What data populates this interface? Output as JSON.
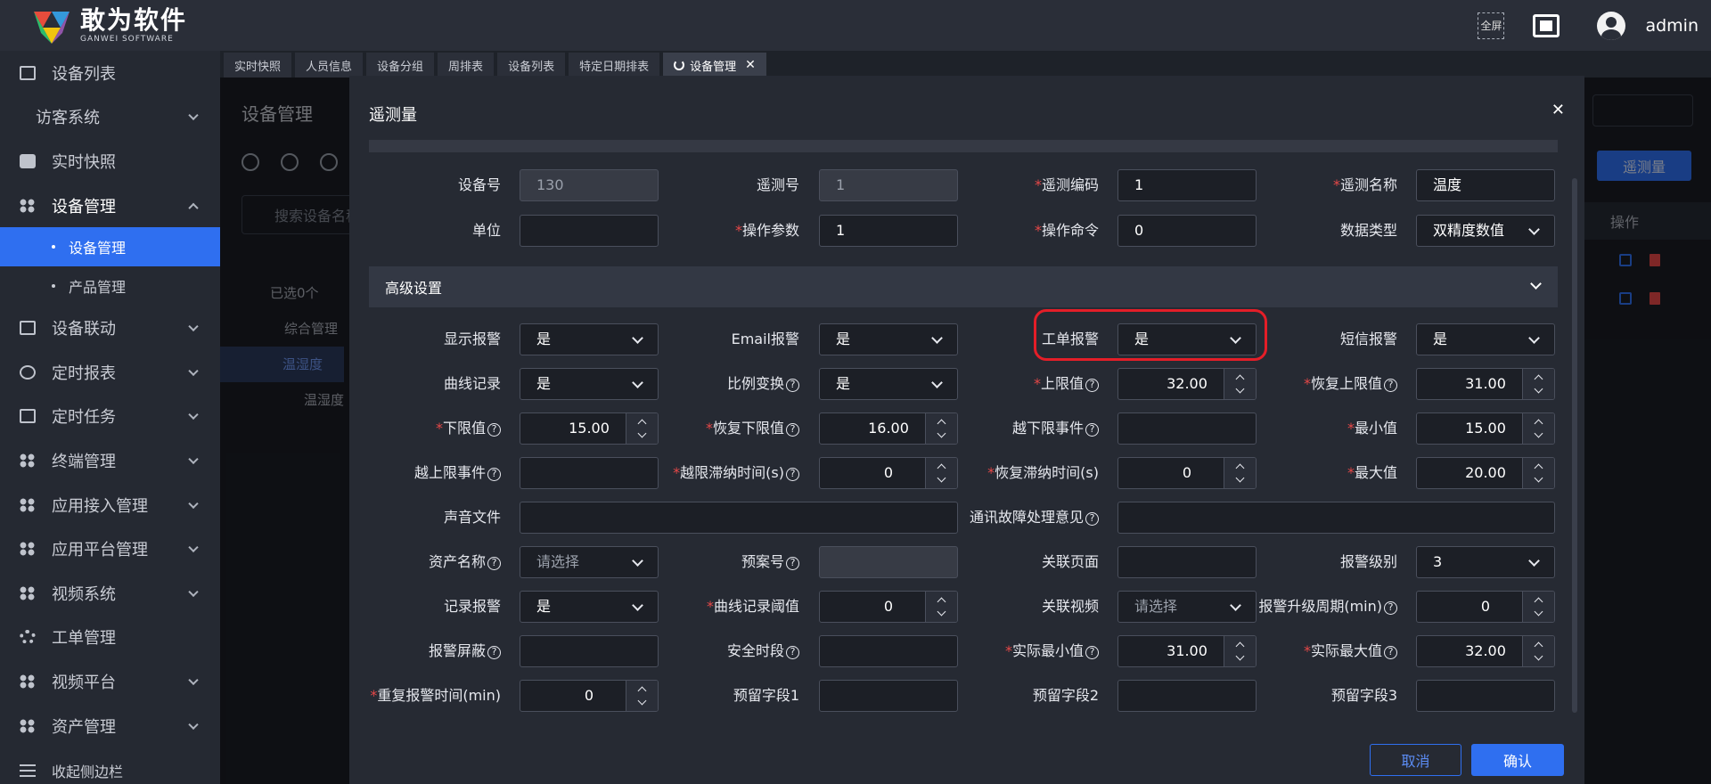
{
  "brand": {
    "name_cn": "敢为软件",
    "name_en": "GANWEI SOFTWARE"
  },
  "topbar": {
    "fullscreen_label": "全屏",
    "user": "admin"
  },
  "sidebar": {
    "items": [
      {
        "label": "设备列表",
        "icon": "monitor-icon",
        "chevron": false
      },
      {
        "label": "访客系统",
        "icon": "none",
        "chevron": true
      },
      {
        "label": "实时快照",
        "icon": "camera-icon",
        "chevron": false
      },
      {
        "label": "设备管理",
        "icon": "grid-icon",
        "chevron": true,
        "open": true
      },
      {
        "label": "设备联动",
        "icon": "link-icon",
        "chevron": true
      },
      {
        "label": "定时报表",
        "icon": "clock-icon",
        "chevron": true
      },
      {
        "label": "定时任务",
        "icon": "task-icon",
        "chevron": true
      },
      {
        "label": "终端管理",
        "icon": "grid-icon",
        "chevron": true
      },
      {
        "label": "应用接入管理",
        "icon": "grid-icon",
        "chevron": true
      },
      {
        "label": "应用平台管理",
        "icon": "grid-icon",
        "chevron": true
      },
      {
        "label": "视频系统",
        "icon": "grid-icon",
        "chevron": true
      },
      {
        "label": "工单管理",
        "icon": "gear-icon",
        "chevron": false
      },
      {
        "label": "视频平台",
        "icon": "grid-icon",
        "chevron": true
      },
      {
        "label": "资产管理",
        "icon": "grid-icon",
        "chevron": true
      }
    ],
    "sub_items": [
      "设备管理",
      "产品管理"
    ],
    "collapse_label": "收起侧边栏"
  },
  "tabs": [
    {
      "label": "实时快照"
    },
    {
      "label": "人员信息"
    },
    {
      "label": "设备分组"
    },
    {
      "label": "周排表"
    },
    {
      "label": "设备列表"
    },
    {
      "label": "特定日期排表"
    },
    {
      "label": "设备管理",
      "active": true
    }
  ],
  "background": {
    "title": "设备管理",
    "search_placeholder": "搜索设备名称",
    "selected_count": "已选0个",
    "tree": [
      "综合管理",
      "温湿度",
      "温湿度"
    ],
    "add_button": "遥测量",
    "table_header": "操作"
  },
  "dialog": {
    "title": "遥测量",
    "section_title": "高级设置",
    "basic": {
      "device_no": {
        "label": "设备号",
        "value": "130"
      },
      "tele_no": {
        "label": "遥测号",
        "value": "1"
      },
      "tele_code": {
        "label": "遥测编码",
        "value": "1"
      },
      "tele_name": {
        "label": "遥测名称",
        "value": "温度"
      },
      "unit": {
        "label": "单位",
        "value": ""
      },
      "op_param": {
        "label": "操作参数",
        "value": "1"
      },
      "op_cmd": {
        "label": "操作命令",
        "value": "0"
      },
      "data_type": {
        "label": "数据类型",
        "value": "双精度数值"
      }
    },
    "adv": {
      "show_alarm": {
        "label": "显示报警",
        "value": "是"
      },
      "email_alarm": {
        "label": "Email报警",
        "value": "是"
      },
      "ticket_alarm": {
        "label": "工单报警",
        "value": "是"
      },
      "sms_alarm": {
        "label": "短信报警",
        "value": "是"
      },
      "curve_record": {
        "label": "曲线记录",
        "value": "是"
      },
      "ratio_transform": {
        "label": "比例变换",
        "value": "是"
      },
      "upper_limit": {
        "label": "上限值",
        "value": "32.00"
      },
      "restore_upper": {
        "label": "恢复上限值",
        "value": "31.00"
      },
      "lower_limit": {
        "label": "下限值",
        "value": "15.00"
      },
      "restore_lower": {
        "label": "恢复下限值",
        "value": "16.00"
      },
      "below_event": {
        "label": "越下限事件",
        "value": ""
      },
      "min_value": {
        "label": "最小值",
        "value": "15.00"
      },
      "above_event": {
        "label": "越上限事件",
        "value": ""
      },
      "limit_delay": {
        "label": "越限滞纳时间(s)",
        "value": "0"
      },
      "restore_delay": {
        "label": "恢复滞纳时间(s)",
        "value": "0"
      },
      "max_value": {
        "label": "最大值",
        "value": "20.00"
      },
      "sound_file": {
        "label": "声音文件",
        "value": ""
      },
      "comm_fault": {
        "label": "通讯故障处理意见",
        "value": ""
      },
      "asset_name": {
        "label": "资产名称",
        "value": "请选择"
      },
      "plan_no": {
        "label": "预案号",
        "value": ""
      },
      "related_page": {
        "label": "关联页面",
        "value": ""
      },
      "alarm_level": {
        "label": "报警级别",
        "value": "3"
      },
      "record_alarm": {
        "label": "记录报警",
        "value": "是"
      },
      "curve_threshold": {
        "label": "曲线记录阈值",
        "value": "0"
      },
      "related_video": {
        "label": "关联视频",
        "value": "请选择"
      },
      "alarm_upgrade": {
        "label": "报警升级周期(min)",
        "value": "0"
      },
      "alarm_mask": {
        "label": "报警屏蔽",
        "value": ""
      },
      "safe_period": {
        "label": "安全时段",
        "value": ""
      },
      "actual_min": {
        "label": "实际最小值",
        "value": "31.00"
      },
      "actual_max": {
        "label": "实际最大值",
        "value": "32.00"
      },
      "repeat_alarm": {
        "label": "重复报警时间(min)",
        "value": "0"
      },
      "reserve1": {
        "label": "预留字段1",
        "value": ""
      },
      "reserve2": {
        "label": "预留字段2",
        "value": ""
      },
      "reserve3": {
        "label": "预留字段3",
        "value": ""
      }
    },
    "cancel_label": "取消",
    "ok_label": "确认"
  },
  "colors": {
    "accent": "#2f6ff0",
    "highlight": "#e41e28",
    "required": "#e54848"
  }
}
